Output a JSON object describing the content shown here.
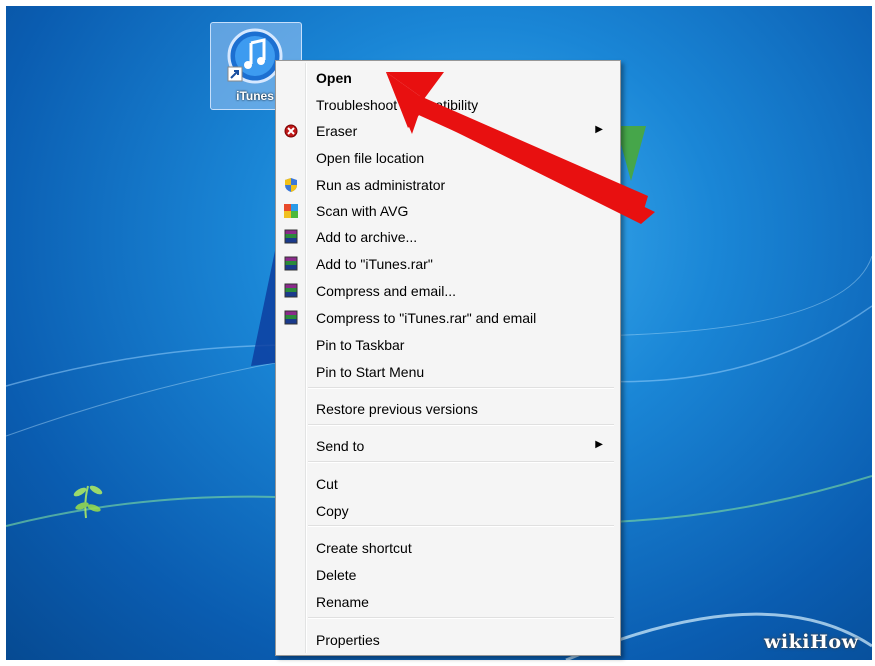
{
  "desktop": {
    "icon_label": "iTunes"
  },
  "context_menu": {
    "items": [
      {
        "label": "Open",
        "icon": "none",
        "bold": true,
        "submenu": false
      },
      {
        "label": "Troubleshoot compatibility",
        "icon": "none",
        "bold": false,
        "submenu": false
      },
      {
        "label": "Eraser",
        "icon": "eraser-icon",
        "bold": false,
        "submenu": true
      },
      {
        "label": "Open file location",
        "icon": "none",
        "bold": false,
        "submenu": false
      },
      {
        "label": "Run as administrator",
        "icon": "uac-shield-icon",
        "bold": false,
        "submenu": false
      },
      {
        "label": "Scan with AVG",
        "icon": "avg-icon",
        "bold": false,
        "submenu": false
      },
      {
        "label": "Add to archive...",
        "icon": "winrar-icon",
        "bold": false,
        "submenu": false
      },
      {
        "label": "Add to \"iTunes.rar\"",
        "icon": "winrar-icon",
        "bold": false,
        "submenu": false
      },
      {
        "label": "Compress and email...",
        "icon": "winrar-icon",
        "bold": false,
        "submenu": false
      },
      {
        "label": "Compress to \"iTunes.rar\" and email",
        "icon": "winrar-icon",
        "bold": false,
        "submenu": false
      },
      {
        "label": "Pin to Taskbar",
        "icon": "none",
        "bold": false,
        "submenu": false
      },
      {
        "label": "Pin to Start Menu",
        "icon": "none",
        "bold": false,
        "submenu": false
      },
      {
        "label": "Restore previous versions",
        "icon": "none",
        "bold": false,
        "submenu": false
      },
      {
        "label": "Send to",
        "icon": "none",
        "bold": false,
        "submenu": true
      },
      {
        "label": "Cut",
        "icon": "none",
        "bold": false,
        "submenu": false
      },
      {
        "label": "Copy",
        "icon": "none",
        "bold": false,
        "submenu": false
      },
      {
        "label": "Create shortcut",
        "icon": "none",
        "bold": false,
        "submenu": false
      },
      {
        "label": "Delete",
        "icon": "none",
        "bold": false,
        "submenu": false
      },
      {
        "label": "Rename",
        "icon": "none",
        "bold": false,
        "submenu": false
      },
      {
        "label": "Properties",
        "icon": "none",
        "bold": false,
        "submenu": false
      }
    ]
  },
  "annotation": {
    "arrow_color": "#ee1111",
    "points_to": "Open"
  },
  "watermark": "wikiHow"
}
